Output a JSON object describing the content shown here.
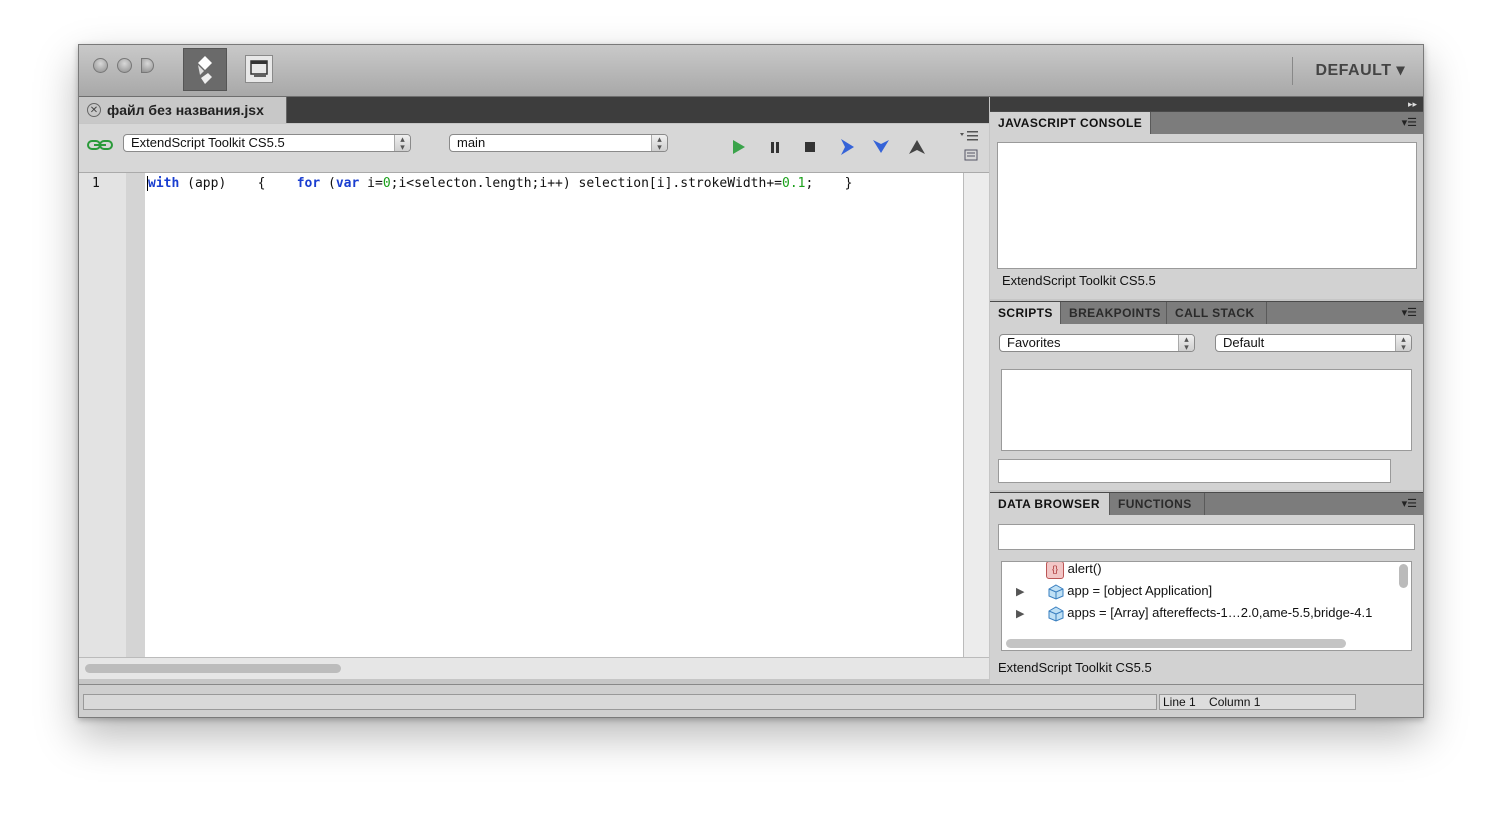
{
  "titlebar": {
    "workspace_label": "DEFAULT ▾"
  },
  "document_tab": {
    "close_glyph": "✕",
    "filename": "файл без названия.jsx"
  },
  "editor_toolbar": {
    "target_app": "ExtendScript Toolkit CS5.5",
    "engine": "main",
    "icons": [
      "link-icon",
      "run-icon",
      "pause-icon",
      "stop-icon",
      "step-over-icon",
      "step-into-icon",
      "step-out-icon",
      "panel-menu-icon",
      "options-icon"
    ]
  },
  "editor": {
    "line_number": "1",
    "code_tokens": {
      "t1": "with",
      "t2": " (app)    {    ",
      "t3": "for",
      "t4": " (",
      "t5": "var",
      "t6": " i=",
      "t7": "0",
      "t8": ";i<selecton.length;i++) selection[i].strokeWidth+=",
      "t9": "0.1",
      "t10": ";    }"
    }
  },
  "console_panel": {
    "tab_label": "JAVASCRIPT CONSOLE",
    "footer": "ExtendScript Toolkit CS5.5"
  },
  "scripts_panel": {
    "tabs": [
      "SCRIPTS",
      "BREAKPOINTS",
      "CALL STACK"
    ],
    "favorites_select": "Favorites",
    "default_select": "Default"
  },
  "data_panel": {
    "tabs": [
      "DATA BROWSER",
      "FUNCTIONS"
    ],
    "rows": [
      {
        "label": "alert()",
        "icon": "function-icon"
      },
      {
        "label": "app = [object Application]",
        "icon": "object-icon"
      },
      {
        "label": "apps = [Array] aftereffects-1…2.0,ame-5.5,bridge-4.1",
        "icon": "object-icon"
      }
    ],
    "footer": "ExtendScript Toolkit CS5.5"
  },
  "statusbar": {
    "line": "Line 1",
    "column": "Column 1"
  },
  "colors": {
    "keyword": "#1a3ed0",
    "number": "#1aa01a",
    "play_green": "#3aa34a",
    "step_blue": "#3563d8"
  }
}
